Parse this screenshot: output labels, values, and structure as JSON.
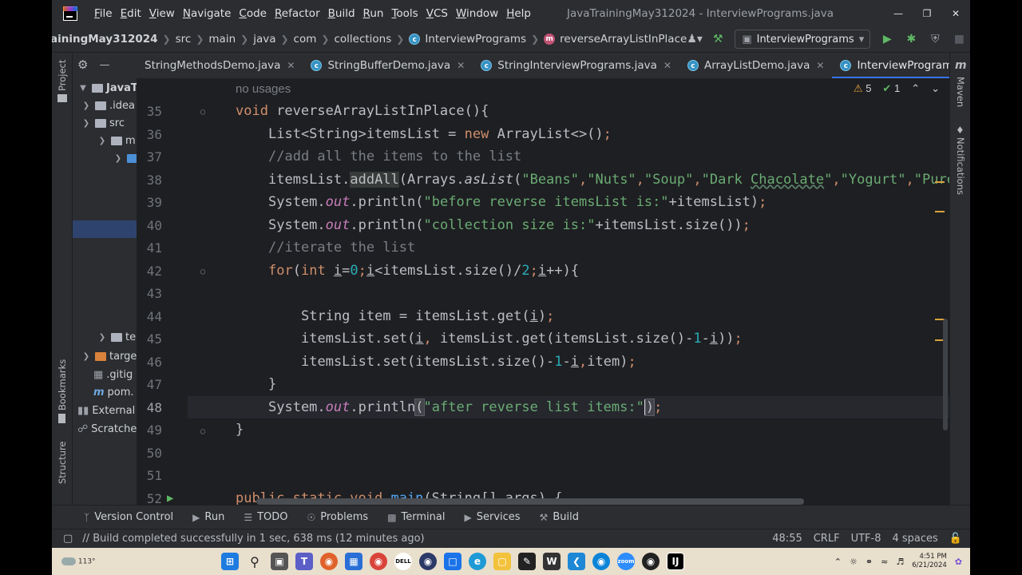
{
  "titlebar": {
    "menu": [
      "File",
      "Edit",
      "View",
      "Navigate",
      "Code",
      "Refactor",
      "Build",
      "Run",
      "Tools",
      "VCS",
      "Window",
      "Help"
    ],
    "window_title": "JavaTrainingMay312024 - InterviewPrograms.java"
  },
  "navbar": {
    "project": "ainingMay312024",
    "crumbs": [
      "src",
      "main",
      "java",
      "com",
      "collections"
    ],
    "class_crumb": "InterviewPrograms",
    "method_crumb": "reverseArrayListInPlace",
    "run_config": "InterviewPrograms"
  },
  "left_strip": {
    "project_label": "Project",
    "bookmarks_label": "Bookmarks",
    "structure_label": "Structure"
  },
  "right_strip": {
    "maven_label": "Maven",
    "notifications_label": "Notifications"
  },
  "project_tree": {
    "root": "JavaTrai",
    "items": [
      ".idea",
      "src",
      "m",
      "te",
      "targe",
      ".gitig",
      "pom.",
      "External",
      "Scratche"
    ]
  },
  "tabs": [
    {
      "label": "StringMethodsDemo.java",
      "active": false
    },
    {
      "label": "StringBufferDemo.java",
      "active": false
    },
    {
      "label": "StringInterviewPrograms.java",
      "active": false
    },
    {
      "label": "ArrayListDemo.java",
      "active": false
    },
    {
      "label": "InterviewPrograms.java",
      "active": true
    }
  ],
  "editor": {
    "usages_hint": "no usages",
    "warnings": "5",
    "checks": "1",
    "line_numbers": [
      "35",
      "36",
      "37",
      "38",
      "39",
      "40",
      "41",
      "42",
      "43",
      "44",
      "45",
      "46",
      "47",
      "48",
      "49",
      "50",
      "51",
      "52"
    ],
    "current_line": "48"
  },
  "bottom_tools": [
    "Version Control",
    "Run",
    "TODO",
    "Problems",
    "Terminal",
    "Services",
    "Build"
  ],
  "statusbar": {
    "message": "// Build completed successfully in 1 sec, 638 ms (12 minutes ago)",
    "position": "48:55",
    "line_sep": "CRLF",
    "encoding": "UTF-8",
    "indent": "4 spaces"
  },
  "taskbar": {
    "weather": "113°",
    "time": "4:51 PM",
    "date": "6/21/2024"
  }
}
